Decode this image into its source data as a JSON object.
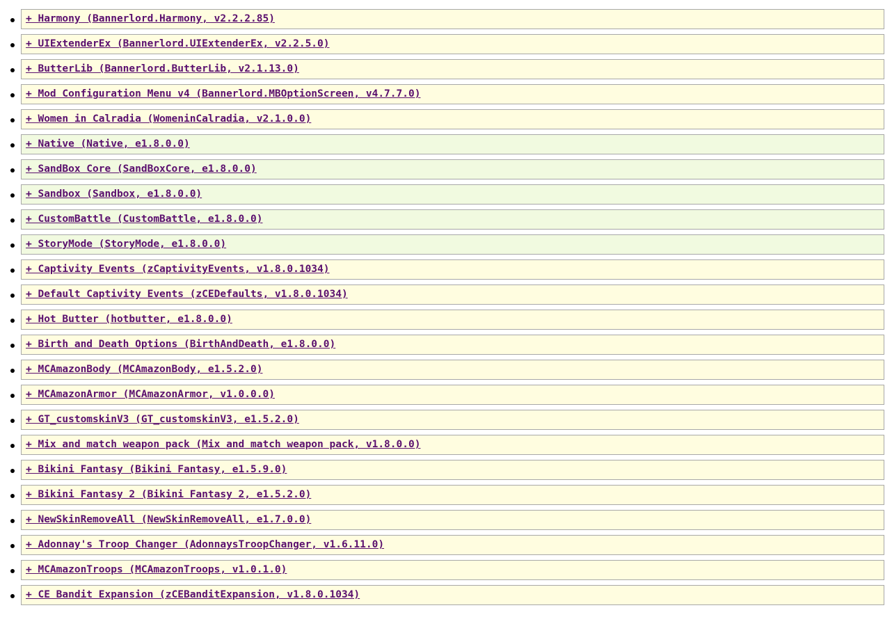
{
  "colors": {
    "external_bg": "#fffde0",
    "official_bg": "#f1fae0",
    "link": "#5a0f6e",
    "border": "#a8a8a8"
  },
  "mods": [
    {
      "text": "+ Harmony (Bannerlord.Harmony, v2.2.2.85)",
      "kind": "external"
    },
    {
      "text": "+ UIExtenderEx (Bannerlord.UIExtenderEx, v2.2.5.0)",
      "kind": "external"
    },
    {
      "text": "+ ButterLib (Bannerlord.ButterLib, v2.1.13.0)",
      "kind": "external"
    },
    {
      "text": "+ Mod Configuration Menu v4 (Bannerlord.MBOptionScreen, v4.7.7.0)",
      "kind": "external"
    },
    {
      "text": "+ Women in Calradia (WomeninCalradia, v2.1.0.0)",
      "kind": "external"
    },
    {
      "text": "+ Native (Native, e1.8.0.0)",
      "kind": "official"
    },
    {
      "text": "+ SandBox Core (SandBoxCore, e1.8.0.0)",
      "kind": "official"
    },
    {
      "text": "+ Sandbox (Sandbox, e1.8.0.0)",
      "kind": "official"
    },
    {
      "text": "+ CustomBattle (CustomBattle, e1.8.0.0)",
      "kind": "official"
    },
    {
      "text": "+ StoryMode (StoryMode, e1.8.0.0)",
      "kind": "official"
    },
    {
      "text": "+ Captivity Events (zCaptivityEvents, v1.8.0.1034)",
      "kind": "external"
    },
    {
      "text": "+ Default Captivity Events (zCEDefaults, v1.8.0.1034)",
      "kind": "external"
    },
    {
      "text": "+ Hot Butter (hotbutter, e1.8.0.0)",
      "kind": "external"
    },
    {
      "text": "+ Birth and Death Options (BirthAndDeath, e1.8.0.0)",
      "kind": "external"
    },
    {
      "text": "+ MCAmazonBody (MCAmazonBody, e1.5.2.0)",
      "kind": "external"
    },
    {
      "text": "+ MCAmazonArmor (MCAmazonArmor, v1.0.0.0)",
      "kind": "external"
    },
    {
      "text": "+ GT_customskinV3 (GT_customskinV3, e1.5.2.0)",
      "kind": "external"
    },
    {
      "text": "+ Mix and match weapon pack (Mix and match weapon pack, v1.8.0.0)",
      "kind": "external"
    },
    {
      "text": "+ Bikini Fantasy (Bikini Fantasy, e1.5.9.0)",
      "kind": "external"
    },
    {
      "text": "+ Bikini Fantasy 2 (Bikini Fantasy 2, e1.5.2.0)",
      "kind": "external"
    },
    {
      "text": "+ NewSkinRemoveAll (NewSkinRemoveAll, e1.7.0.0)",
      "kind": "external"
    },
    {
      "text": "+ Adonnay's Troop Changer (AdonnaysTroopChanger, v1.6.11.0)",
      "kind": "external"
    },
    {
      "text": "+ MCAmazonTroops (MCAmazonTroops, v1.0.1.0)",
      "kind": "external"
    },
    {
      "text": "+ CE Bandit Expansion (zCEBanditExpansion, v1.8.0.1034)",
      "kind": "external"
    }
  ]
}
